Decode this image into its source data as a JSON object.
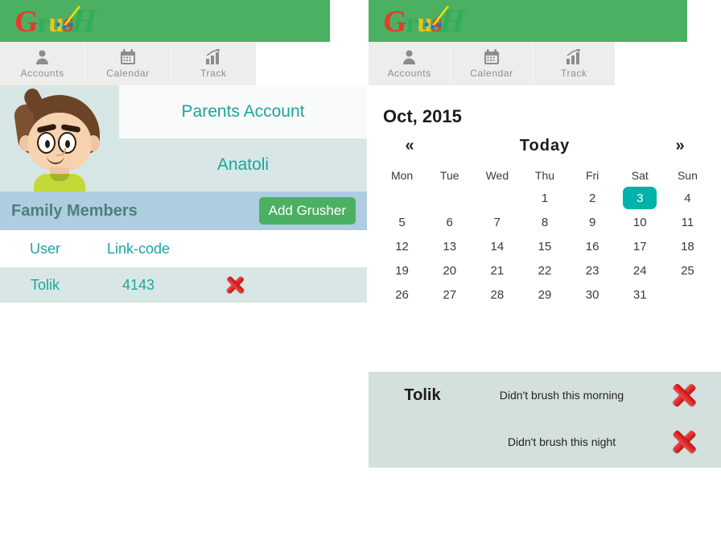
{
  "app": {
    "logo_text": "Grush",
    "logo_letters": [
      "G",
      "r",
      "u",
      "s",
      "H"
    ],
    "header_color": "#4BB062",
    "accent_teal": "#1BA5A0",
    "highlight_teal": "#00B2A9"
  },
  "tabs": [
    {
      "label": "Accounts",
      "icon": "person-icon"
    },
    {
      "label": "Calendar",
      "icon": "calendar-icon"
    },
    {
      "label": "Track",
      "icon": "bar-chart-icon"
    }
  ],
  "accounts": {
    "avatar_alt": "boy-avatar",
    "rows": [
      {
        "label": "Parents Account"
      },
      {
        "label": "Anatoli"
      }
    ]
  },
  "family": {
    "title": "Family Members",
    "add_button": "Add Grusher",
    "columns": [
      "User",
      "Link-code",
      ""
    ],
    "rows": [
      {
        "user": "Tolik",
        "link_code": "4143",
        "action_icon": "red-x-icon"
      }
    ]
  },
  "calendar": {
    "title": "Oct, 2015",
    "prev_label": "«",
    "today_label": "Today",
    "next_label": "»",
    "day_names": [
      "Mon",
      "Tue",
      "Wed",
      "Thu",
      "Fri",
      "Sat",
      "Sun"
    ],
    "selected_day": 3,
    "weeks": [
      [
        "",
        "",
        "",
        "1",
        "2",
        "3",
        "4"
      ],
      [
        "5",
        "6",
        "7",
        "8",
        "9",
        "10",
        "11"
      ],
      [
        "12",
        "13",
        "14",
        "15",
        "16",
        "17",
        "18"
      ],
      [
        "19",
        "20",
        "21",
        "22",
        "23",
        "24",
        "25"
      ],
      [
        "26",
        "27",
        "28",
        "29",
        "30",
        "31",
        ""
      ]
    ]
  },
  "brush_log": {
    "name": "Tolik",
    "entries": [
      {
        "text": "Didn't brush this morning",
        "icon": "red-x-icon"
      },
      {
        "text": "Didn't brush this night",
        "icon": "red-x-icon"
      }
    ]
  }
}
